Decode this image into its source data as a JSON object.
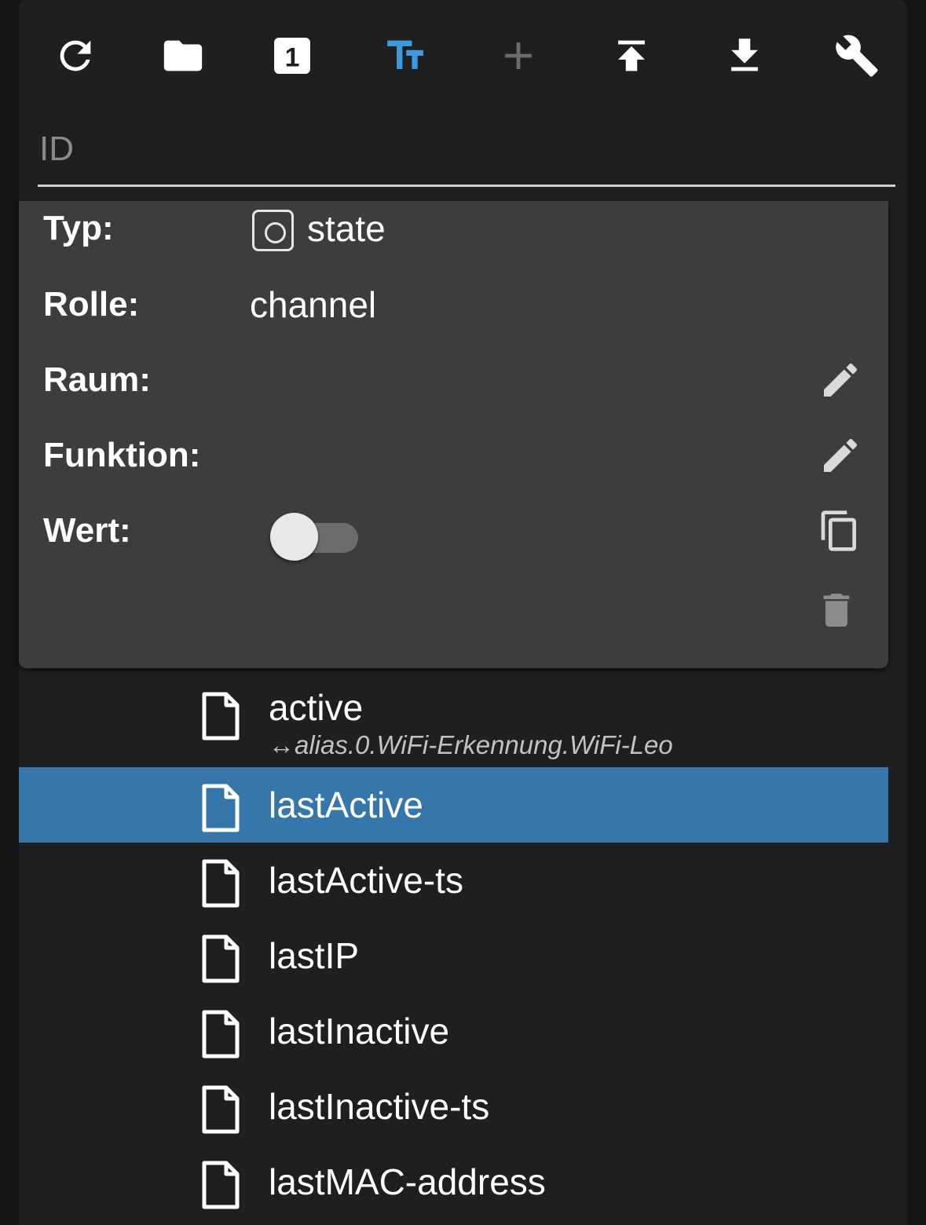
{
  "toolbar": {
    "buttons": [
      {
        "name": "refresh",
        "icon": "refresh-icon",
        "enabled": true
      },
      {
        "name": "folder",
        "icon": "folder-icon",
        "enabled": true
      },
      {
        "name": "counter",
        "icon": "numbered-box-icon",
        "label": "1",
        "enabled": true
      },
      {
        "name": "text-size",
        "icon": "text-size-icon",
        "enabled": true,
        "active_color": "#3e9ae0"
      },
      {
        "name": "add",
        "icon": "plus-icon",
        "enabled": false
      },
      {
        "name": "upload",
        "icon": "upload-icon",
        "enabled": true
      },
      {
        "name": "download",
        "icon": "download-icon",
        "enabled": true
      },
      {
        "name": "settings",
        "icon": "wrench-icon",
        "enabled": true
      }
    ]
  },
  "filter": {
    "placeholder": "ID",
    "value": ""
  },
  "details": {
    "typ": {
      "label": "Typ:",
      "value": "state",
      "icon": "state-icon"
    },
    "rolle": {
      "label": "Rolle:",
      "value": "channel"
    },
    "raum": {
      "label": "Raum:",
      "value": "",
      "action_icon": "pencil-icon"
    },
    "funktion": {
      "label": "Funktion:",
      "value": "",
      "action_icon": "pencil-icon"
    },
    "wert": {
      "label": "Wert:",
      "value": false,
      "action_icon": "copy-icon"
    },
    "delete_icon": "trash-icon"
  },
  "list": {
    "items": [
      {
        "name": "active",
        "alias": "↔alias.0.WiFi-Erkennung.WiFi-Leo",
        "selected": false
      },
      {
        "name": "lastActive",
        "selected": true
      },
      {
        "name": "lastActive-ts",
        "selected": false
      },
      {
        "name": "lastIP",
        "selected": false
      },
      {
        "name": "lastInactive",
        "selected": false
      },
      {
        "name": "lastInactive-ts",
        "selected": false
      },
      {
        "name": "lastMAC-address",
        "selected": false
      }
    ]
  },
  "colors": {
    "background": "#1f1f20",
    "card": "#3d3d3e",
    "selection": "#3677ab",
    "accent": "#3e9ae0"
  }
}
